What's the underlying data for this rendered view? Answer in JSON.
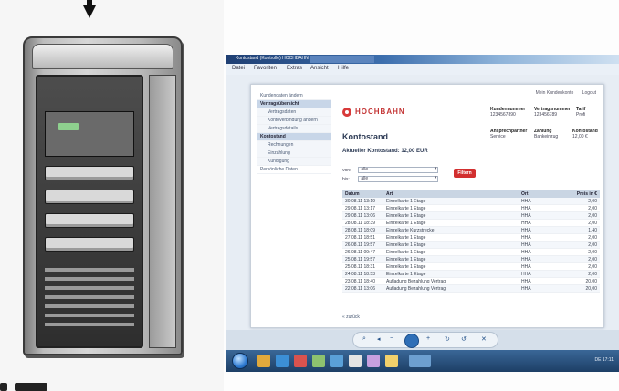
{
  "window": {
    "title": "Kontostand (Kontrolle) HOCHBAHN",
    "tab": "HOCHBAHN"
  },
  "menu": {
    "items": [
      "Datei",
      "Favoriten",
      "Extras",
      "Ansicht",
      "Hilfe"
    ]
  },
  "page": {
    "top_links": [
      "Mein Kundenkonto",
      "Logout"
    ],
    "nav_items": [
      {
        "label": "Kundendaten ändern",
        "level": 0,
        "active": false
      },
      {
        "label": "Vertragsübersicht",
        "level": 0,
        "active": true
      },
      {
        "label": "Vertragsdaten",
        "level": 1,
        "active": false
      },
      {
        "label": "Kontoverbindung ändern",
        "level": 1,
        "active": false
      },
      {
        "label": "Vertragsdetails",
        "level": 1,
        "active": false
      },
      {
        "label": "Kontostand",
        "level": 0,
        "active": true
      },
      {
        "label": "Rechnungen",
        "level": 1,
        "active": false
      },
      {
        "label": "Einzahlung",
        "level": 1,
        "active": false
      },
      {
        "label": "Kündigung",
        "level": 1,
        "active": false
      },
      {
        "label": "Persönliche Daten",
        "level": 0,
        "active": false
      }
    ],
    "logo_text": "HOCHBAHN",
    "info_top": [
      {
        "label": "Kundennummer",
        "value": "1234567890"
      },
      {
        "label": "Vertragsnummer",
        "value": "123456789"
      },
      {
        "label": "Tarif",
        "value": "Profi"
      }
    ],
    "info_bottom": [
      {
        "label": "Ansprechpartner",
        "value": "Service"
      },
      {
        "label": "Zahlung",
        "value": "Bankeinzug"
      },
      {
        "label": "Kontostand",
        "value": "12,00 €"
      }
    ],
    "heading": "Kontostand",
    "subheading": "Aktueller Kontostand: 12,00 EUR",
    "filters": [
      {
        "label": "von:",
        "value": "alle"
      },
      {
        "label": "bis:",
        "value": "alle"
      }
    ],
    "filter_button": "Filtern",
    "table": {
      "headers": [
        "Datum",
        "Art",
        "Ort",
        "Preis in €"
      ],
      "rows": [
        [
          "30.08.11 13:19",
          "Einzelkarte 1 Etage",
          "HHA",
          "2,00"
        ],
        [
          "29.08.11 13:17",
          "Einzelkarte 1 Etage",
          "HHA",
          "2,00"
        ],
        [
          "29.08.11 13:06",
          "Einzelkarte 1 Etage",
          "HHA",
          "2,00"
        ],
        [
          "28.08.11 18:39",
          "Einzelkarte 1 Etage",
          "HHA",
          "2,00"
        ],
        [
          "28.08.11 18:09",
          "Einzelkarte Kurzstrecke",
          "HHA",
          "1,40"
        ],
        [
          "27.08.11 18:51",
          "Einzelkarte 1 Etage",
          "HHA",
          "2,00"
        ],
        [
          "26.08.11 19:57",
          "Einzelkarte 1 Etage",
          "HHA",
          "2,00"
        ],
        [
          "26.08.11 09:47",
          "Einzelkarte 1 Etage",
          "HHA",
          "2,00"
        ],
        [
          "25.08.11 19:57",
          "Einzelkarte 1 Etage",
          "HHA",
          "2,00"
        ],
        [
          "25.08.11 18:31",
          "Einzelkarte 1 Etage",
          "HHA",
          "2,00"
        ],
        [
          "24.08.11 18:53",
          "Einzelkarte 1 Etage",
          "HHA",
          "2,00"
        ],
        [
          "23.08.11 18:40",
          "Aufladung Bezahlung Vertrag",
          "HHA",
          "20,00"
        ],
        [
          "22.08.11 13:06",
          "Aufladung Bezahlung Vertrag",
          "HHA",
          "20,00"
        ]
      ]
    },
    "bottom_link": "« zurück"
  },
  "taskbar": {
    "tray": "DE  17:11"
  },
  "colors": {
    "brand_red": "#d22f2f",
    "nav_active": "#c8d6e8",
    "taskbar": "#1d3f66"
  }
}
